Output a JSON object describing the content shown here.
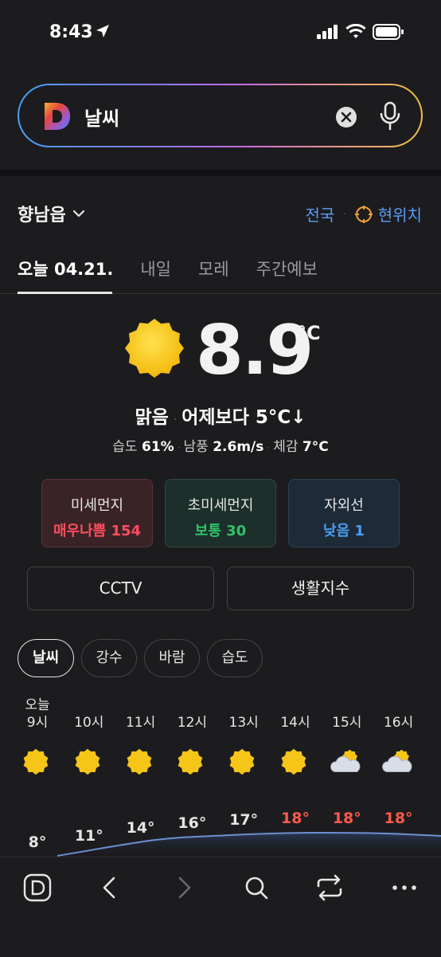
{
  "status_bar": {
    "time": "8:43",
    "icons": [
      "location-arrow-icon",
      "signal-icon",
      "wifi-icon",
      "battery-icon"
    ]
  },
  "search": {
    "value": "날씨",
    "icons": [
      "daum-logo-icon",
      "clear-icon",
      "mic-icon"
    ]
  },
  "location": {
    "name": "향남읍",
    "national_label": "전국",
    "current_label": "현위치"
  },
  "tabs": [
    {
      "label": "오늘 04.21.",
      "active": true
    },
    {
      "label": "내일",
      "active": false
    },
    {
      "label": "모레",
      "active": false
    },
    {
      "label": "주간예보",
      "active": false
    }
  ],
  "current": {
    "temperature": "8.9",
    "unit": "°C",
    "condition": "맑음",
    "compare": "어제보다 5°C↓",
    "humidity_label": "습도",
    "humidity_value": "61%",
    "wind_label": "남풍",
    "wind_value": "2.6m/s",
    "feels_label": "체감",
    "feels_value": "7°C"
  },
  "air_cards": [
    {
      "label": "미세먼지",
      "value": "매우나쁨 154",
      "color": "#ff4d5e"
    },
    {
      "label": "초미세먼지",
      "value": "보통 30",
      "color": "#2fc36a"
    },
    {
      "label": "자외선",
      "value": "낮음 1",
      "color": "#4a9ff5"
    }
  ],
  "buttons": {
    "cctv": "CCTV",
    "living_index": "생활지수"
  },
  "pills": [
    {
      "label": "날씨",
      "active": true
    },
    {
      "label": "강수",
      "active": false
    },
    {
      "label": "바람",
      "active": false
    },
    {
      "label": "습도",
      "active": false
    }
  ],
  "hourly": {
    "today_label": "오늘",
    "hours": [
      {
        "time": "9시",
        "icon": "sun-icon",
        "temp": "8°",
        "hot": false
      },
      {
        "time": "10시",
        "icon": "sun-icon",
        "temp": "11°",
        "hot": false
      },
      {
        "time": "11시",
        "icon": "sun-icon",
        "temp": "14°",
        "hot": false
      },
      {
        "time": "12시",
        "icon": "sun-icon",
        "temp": "16°",
        "hot": false
      },
      {
        "time": "13시",
        "icon": "sun-icon",
        "temp": "17°",
        "hot": false
      },
      {
        "time": "14시",
        "icon": "sun-icon",
        "temp": "18°",
        "hot": true
      },
      {
        "time": "15시",
        "icon": "partly-cloudy-icon",
        "temp": "18°",
        "hot": true
      },
      {
        "time": "16시",
        "icon": "partly-cloudy-icon",
        "temp": "18°",
        "hot": true
      }
    ]
  },
  "bottom_nav": [
    "daum-home-icon",
    "back-icon",
    "forward-icon",
    "search-icon",
    "refresh-icon",
    "more-icon"
  ],
  "colors": {
    "background": "#1c1c1f",
    "accent_blue": "#5b9cf5",
    "sun": "#f5c518",
    "hot_temp": "#ff5a4a"
  }
}
